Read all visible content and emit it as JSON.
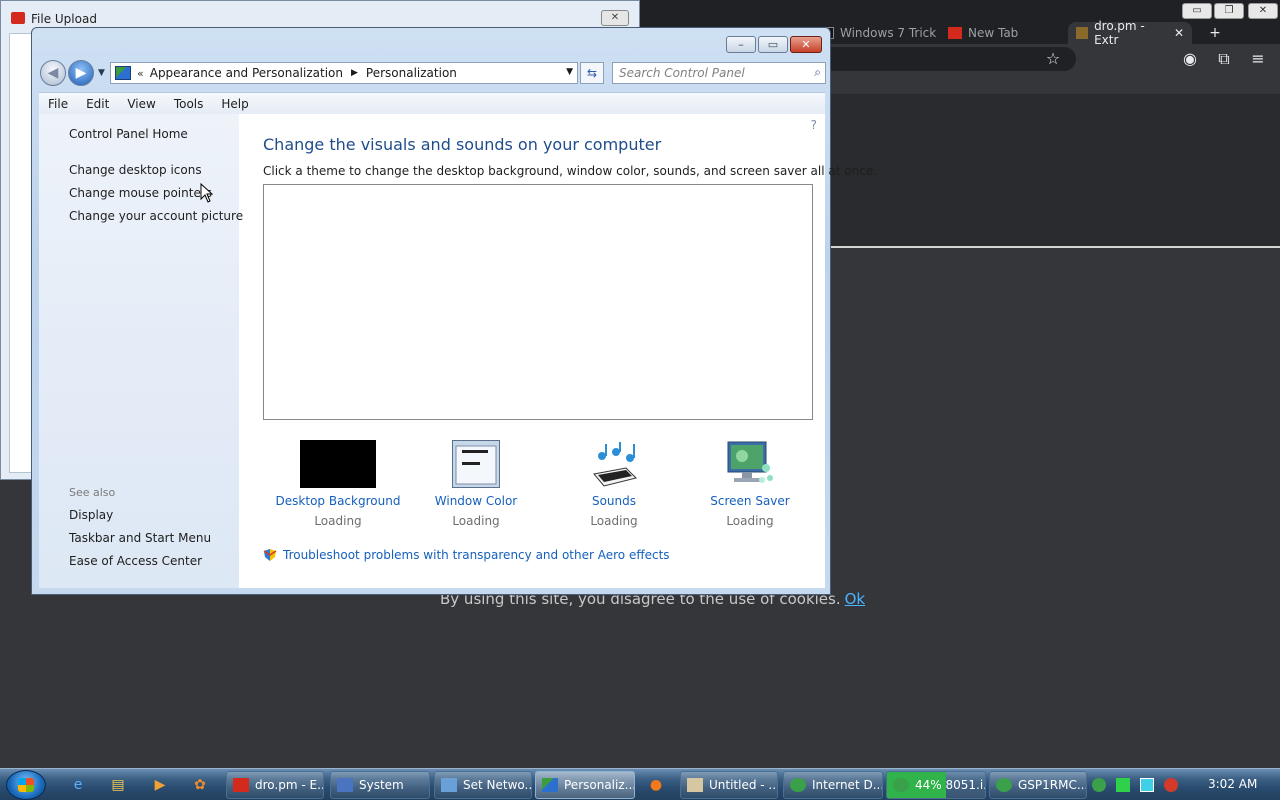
{
  "browser": {
    "tabs": [
      {
        "label": "Windows 7 Trick"
      },
      {
        "label": "New Tab"
      },
      {
        "label": "dro.pm - Extr",
        "active": true
      }
    ],
    "cookie_text": "By using this site, you disagree to the use of cookies.",
    "cookie_ok": "Ok"
  },
  "file_upload": {
    "title": "File Upload"
  },
  "control_panel": {
    "breadcrumb": [
      "«",
      "Appearance and Personalization",
      "Personalization"
    ],
    "search_placeholder": "Search Control Panel",
    "menu": [
      "File",
      "Edit",
      "View",
      "Tools",
      "Help"
    ],
    "sidebar": {
      "home": "Control Panel Home",
      "links": [
        "Change desktop icons",
        "Change mouse pointers",
        "Change your account picture"
      ],
      "see_also_heading": "See also",
      "see_also": [
        "Display",
        "Taskbar and Start Menu",
        "Ease of Access Center"
      ]
    },
    "main": {
      "title": "Change the visuals and sounds on your computer",
      "description": "Click a theme to change the desktop background, window color, sounds, and screen saver all at once.",
      "options": [
        {
          "label": "Desktop Background",
          "status": "Loading",
          "icon": "desktop-background-icon"
        },
        {
          "label": "Window Color",
          "status": "Loading",
          "icon": "window-color-icon"
        },
        {
          "label": "Sounds",
          "status": "Loading",
          "icon": "sounds-icon"
        },
        {
          "label": "Screen Saver",
          "status": "Loading",
          "icon": "screen-saver-icon"
        }
      ],
      "troubleshoot": "Troubleshoot problems with transparency and other Aero effects"
    }
  },
  "taskbar": {
    "buttons": [
      {
        "label": "dro.pm - E...",
        "icon": "mail-icon"
      },
      {
        "label": "System",
        "icon": "system-icon"
      },
      {
        "label": "Set Netwo...",
        "icon": "network-icon"
      },
      {
        "label": "Personaliz...",
        "icon": "control-panel-icon",
        "active": true
      },
      {
        "label": "Untitled - ...",
        "icon": "paint-icon"
      },
      {
        "label": "Internet D...",
        "icon": "globe-icon"
      },
      {
        "label": "44% 8051.i...",
        "icon": "download-icon",
        "progress": 0.44
      },
      {
        "label": "GSP1RMC...",
        "icon": "globe-icon"
      }
    ],
    "clock": "3:02 AM"
  },
  "colors": {
    "link_blue": "#1560bd",
    "title_blue": "#1f4d8c",
    "taskbar": "#2a4c70"
  }
}
